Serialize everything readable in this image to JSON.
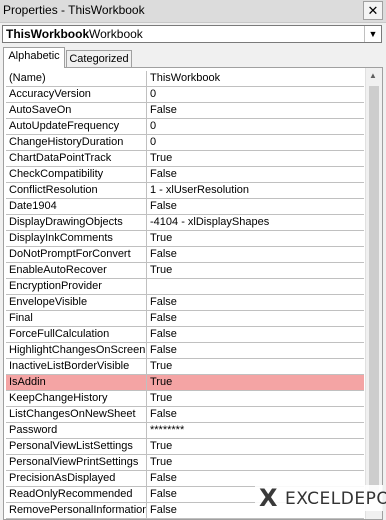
{
  "window": {
    "title": "Properties - ThisWorkbook",
    "close_label": "✕"
  },
  "object_selector": {
    "name": "ThisWorkbook",
    "type": "Workbook",
    "dropdown_icon": "chevron-down-icon"
  },
  "tabs": [
    {
      "label": "Alphabetic",
      "active": true
    },
    {
      "label": "Categorized",
      "active": false
    }
  ],
  "properties": [
    {
      "name": "(Name)",
      "value": "ThisWorkbook"
    },
    {
      "name": "AccuracyVersion",
      "value": "0"
    },
    {
      "name": "AutoSaveOn",
      "value": "False"
    },
    {
      "name": "AutoUpdateFrequency",
      "value": "0"
    },
    {
      "name": "ChangeHistoryDuration",
      "value": "0"
    },
    {
      "name": "ChartDataPointTrack",
      "value": "True"
    },
    {
      "name": "CheckCompatibility",
      "value": "False"
    },
    {
      "name": "ConflictResolution",
      "value": "1 - xlUserResolution"
    },
    {
      "name": "Date1904",
      "value": "False"
    },
    {
      "name": "DisplayDrawingObjects",
      "value": "-4104 - xlDisplayShapes"
    },
    {
      "name": "DisplayInkComments",
      "value": "True"
    },
    {
      "name": "DoNotPromptForConvert",
      "value": "False"
    },
    {
      "name": "EnableAutoRecover",
      "value": "True"
    },
    {
      "name": "EncryptionProvider",
      "value": ""
    },
    {
      "name": "EnvelopeVisible",
      "value": "False"
    },
    {
      "name": "Final",
      "value": "False"
    },
    {
      "name": "ForceFullCalculation",
      "value": "False"
    },
    {
      "name": "HighlightChangesOnScreen",
      "value": "False"
    },
    {
      "name": "InactiveListBorderVisible",
      "value": "True"
    },
    {
      "name": "IsAddin",
      "value": "True",
      "highlighted": true
    },
    {
      "name": "KeepChangeHistory",
      "value": "True"
    },
    {
      "name": "ListChangesOnNewSheet",
      "value": "False"
    },
    {
      "name": "Password",
      "value": "********"
    },
    {
      "name": "PersonalViewListSettings",
      "value": "True"
    },
    {
      "name": "PersonalViewPrintSettings",
      "value": "True"
    },
    {
      "name": "PrecisionAsDisplayed",
      "value": "False"
    },
    {
      "name": "ReadOnlyRecommended",
      "value": "False"
    },
    {
      "name": "RemovePersonalInformation",
      "value": "False"
    }
  ],
  "watermark": {
    "mark": "X",
    "text": "EXCELDEPO"
  },
  "colors": {
    "highlight_row": "#f4a4a4"
  }
}
